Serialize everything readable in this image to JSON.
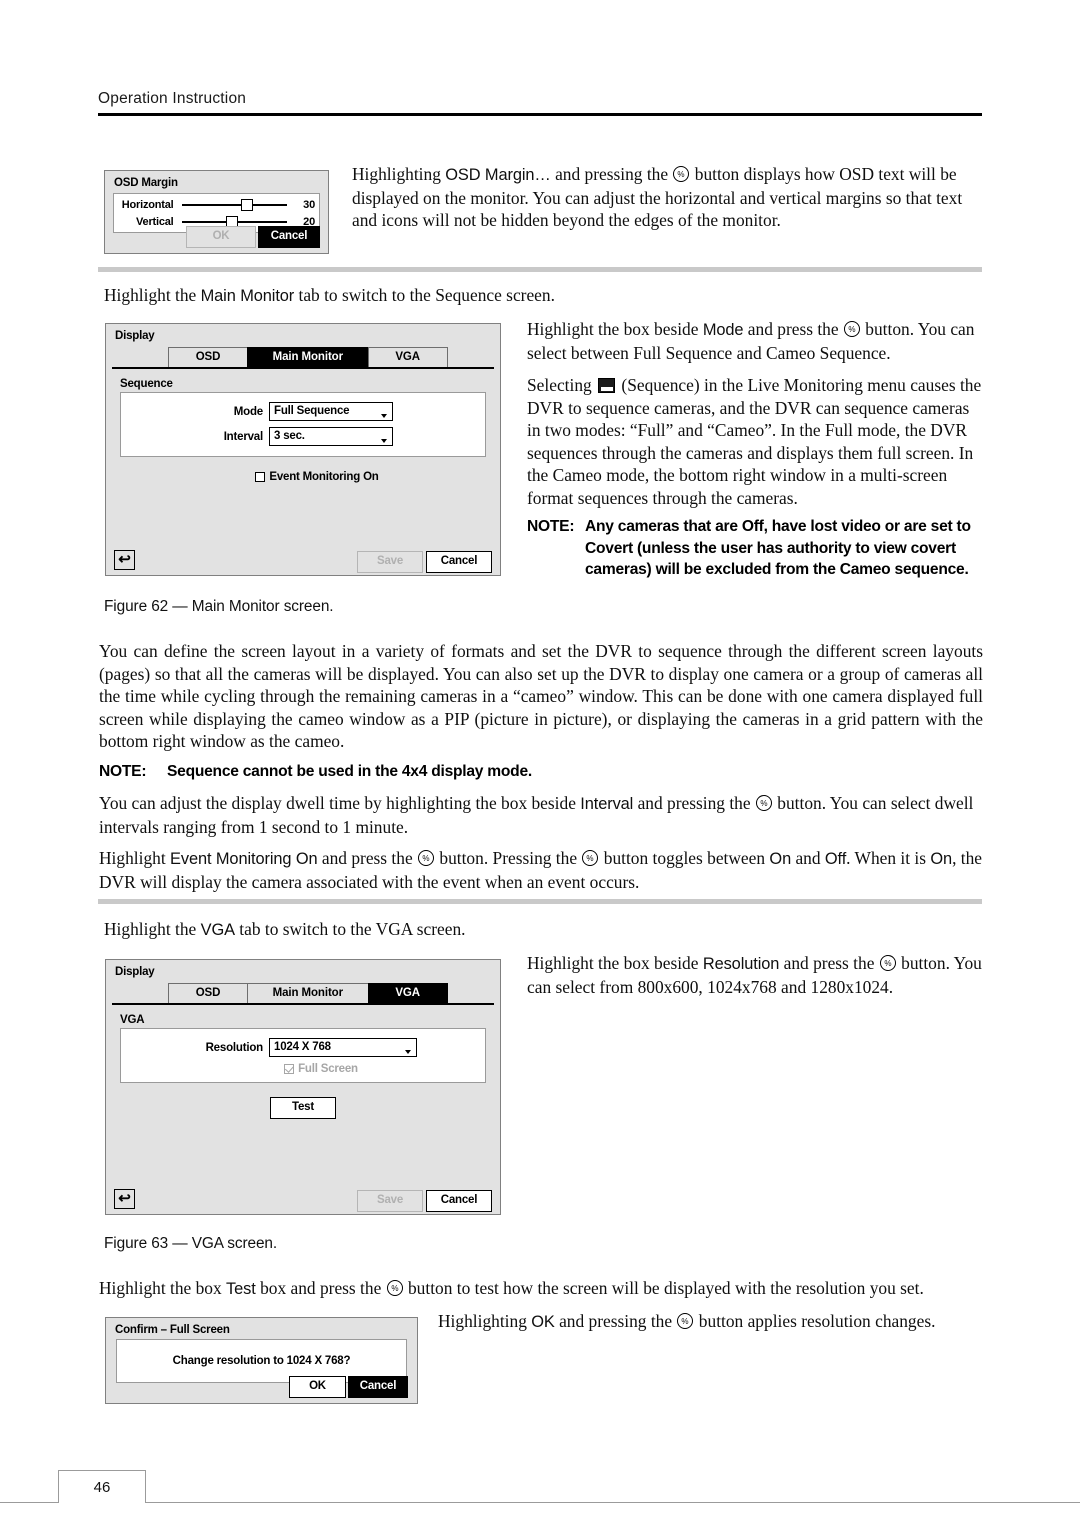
{
  "header": {
    "title": "Operation Instruction"
  },
  "osd_margin_dialog": {
    "title": "OSD Margin",
    "rows": [
      {
        "label": "Horizontal",
        "value": "30",
        "knob_pct": 56
      },
      {
        "label": "Vertical",
        "value": "20",
        "knob_pct": 42
      }
    ],
    "ok_label": "OK",
    "cancel_label": "Cancel"
  },
  "paragraphs": {
    "osd_margin_intro_a": "Highlighting ",
    "osd_margin_term": "OSD Margin…",
    "osd_margin_intro_b": " and pressing the ",
    "osd_margin_intro_c": " button displays how OSD text will be displayed on the monitor.  You can adjust the horizontal and vertical margins so that text and icons will not be hidden beyond the edges of the monitor.",
    "main_monitor_tab_a": "Highlight the ",
    "main_monitor_tab_term": "Main Monitor",
    "main_monitor_tab_b": " tab to switch to the Sequence screen.",
    "mode_a": "Highlight the box beside ",
    "mode_term": "Mode",
    "mode_b": " and press the ",
    "mode_c": " button.  You can select between Full Sequence and Cameo Sequence.",
    "sequence_a": "Selecting ",
    "sequence_b": " (Sequence) in the Live Monitoring menu causes the DVR to sequence cameras, and the DVR can sequence cameras in two modes: “Full” and “Cameo”.  In the Full mode, the DVR sequences through the cameras and displays them full screen.  In the Cameo mode, the bottom right window in a multi-screen format sequences through the cameras.",
    "note_cameo_label": "NOTE:",
    "note_cameo_body": "Any cameras that are Off, have lost video or are set to Covert (unless the user has authority to view covert cameras) will be excluded from the Cameo sequence.",
    "figure_62": "Figure 62 — Main Monitor screen.",
    "layout_body": "You can define the screen layout in a variety of formats and set the DVR to sequence through the different screen layouts (pages) so that all the cameras will be displayed.  You can also set up the DVR to display one camera or a group of cameras all the time while cycling through the remaining cameras in a “cameo” window.  This can be done with one camera displayed full screen while displaying the cameo window as a PIP (picture in picture), or displaying the cameras in a grid pattern with the bottom right window as the cameo.",
    "note_4x4_label": "NOTE:",
    "note_4x4_body": "Sequence cannot be used in the 4x4 display mode.",
    "interval_a": "You can adjust the display dwell time by highlighting the box beside ",
    "interval_term": "Interval",
    "interval_b": " and pressing the ",
    "interval_c": " button.  You can select dwell intervals ranging from 1 second to 1 minute.",
    "event_a": "Highlight ",
    "event_term": "Event Monitoring On",
    "event_b": " and press the ",
    "event_c": " button.  Pressing the ",
    "event_d": " button toggles between ",
    "event_on": "On",
    "event_e": " and ",
    "event_off": "Off",
    "event_f": ".  When it is ",
    "event_on2": "On",
    "event_g": ", the DVR will display the camera associated with the event when an event occurs.",
    "vga_tab_a": "Highlight the ",
    "vga_tab_term": "VGA",
    "vga_tab_b": " tab to switch to the VGA screen.",
    "resolution_a": "Highlight the box beside ",
    "resolution_term": "Resolution",
    "resolution_b": " and press the ",
    "resolution_c": " button. You can select from 800x600, 1024x768 and 1280x1024.",
    "figure_63": "Figure 63 — VGA screen.",
    "test_a": "Highlight the box ",
    "test_term": "Test",
    "test_b": " box and press the ",
    "test_c": " button to test how the screen will be displayed with the resolution you set.",
    "confirm_ok_a": "Highlighting ",
    "confirm_ok_term": "OK",
    "confirm_ok_b": " and pressing the ",
    "confirm_ok_c": " button applies resolution changes."
  },
  "main_monitor_dialog": {
    "title": "Display",
    "tabs": [
      {
        "label": "OSD",
        "active": false
      },
      {
        "label": "Main Monitor",
        "active": true
      },
      {
        "label": "VGA",
        "active": false
      }
    ],
    "group_label": "Sequence",
    "fields": [
      {
        "label": "Mode",
        "value": "Full Sequence"
      },
      {
        "label": "Interval",
        "value": "3 sec."
      }
    ],
    "checkbox_label": "Event Monitoring On",
    "checkbox_checked": false,
    "back_icon": "back-arrow-icon",
    "save_label": "Save",
    "cancel_label": "Cancel"
  },
  "vga_dialog": {
    "title": "Display",
    "tabs": [
      {
        "label": "OSD",
        "active": false
      },
      {
        "label": "Main Monitor",
        "active": false
      },
      {
        "label": "VGA",
        "active": true
      }
    ],
    "group_label": "VGA",
    "resolution_label": "Resolution",
    "resolution_value": "1024 X 768",
    "fullscreen_label": "Full Screen",
    "fullscreen_checked": true,
    "test_label": "Test",
    "back_icon": "back-arrow-icon",
    "save_label": "Save",
    "cancel_label": "Cancel"
  },
  "confirm_dialog": {
    "title": "Confirm – Full Screen",
    "message": "Change resolution to 1024 X 768?",
    "ok_label": "OK",
    "cancel_label": "Cancel"
  },
  "footer": {
    "page_number": "46"
  },
  "colors": {
    "dialog_bg": "#e2e2e2",
    "dialog_border": "#808080",
    "separator": "#c9c9c9",
    "rule": "#000000",
    "footer_rule": "#9b9b9b"
  }
}
